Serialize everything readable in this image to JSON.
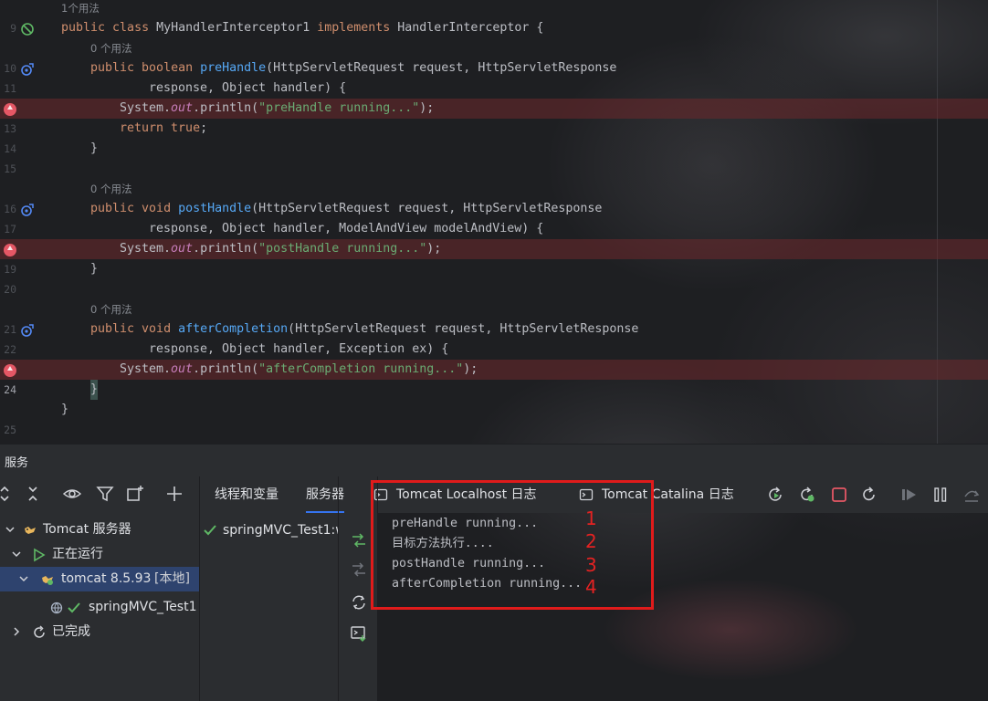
{
  "editor": {
    "usage_hints": [
      "1个用法",
      "0 个用法",
      "0 个用法",
      "0 个用法"
    ],
    "lines": {
      "9": {
        "kw1": "public ",
        "kw2": "class ",
        "name": "MyHandlerInterceptor1 ",
        "kw3": "implements ",
        "rest": "HandlerInterceptor {"
      },
      "10": {
        "kw1": "public ",
        "kw2": "boolean ",
        "fn": "preHandle",
        "rest": "(HttpServletRequest request, HttpServletResponse"
      },
      "11": {
        "text": "response, Object handler) {"
      },
      "12": {
        "a": "System.",
        "field": "out",
        "b": ".println(",
        "str": "\"preHandle running...\"",
        "c": ");"
      },
      "13": {
        "kw1": "return ",
        "kw2": "true",
        "rest": ";"
      },
      "14": {
        "text": "}"
      },
      "16": {
        "kw1": "public ",
        "kw2": "void ",
        "fn": "postHandle",
        "rest": "(HttpServletRequest request, HttpServletResponse"
      },
      "17": {
        "text": "response, Object handler, ModelAndView modelAndView) {"
      },
      "18": {
        "a": "System.",
        "field": "out",
        "b": ".println(",
        "str": "\"postHandle running...\"",
        "c": ");"
      },
      "19": {
        "text": "}"
      },
      "21": {
        "kw1": "public ",
        "kw2": "void ",
        "fn": "afterCompletion",
        "rest": "(HttpServletRequest request, HttpServletResponse"
      },
      "22": {
        "text": "response, Object handler, Exception ex) {"
      },
      "23": {
        "a": "System.",
        "field": "out",
        "b": ".println(",
        "str": "\"afterCompletion running...\"",
        "c": ");"
      },
      "24": {
        "text": "}"
      },
      "25": {
        "text": "}"
      }
    },
    "line_numbers": [
      "9",
      "10",
      "11",
      "12",
      "13",
      "14",
      "15",
      "16",
      "17",
      "18",
      "19",
      "20",
      "21",
      "22",
      "23",
      "24",
      "25"
    ]
  },
  "services": {
    "title": "服务",
    "tree": {
      "tomcat_group": "Tomcat 服务器",
      "running": "正在运行",
      "server": "tomcat 8.5.93",
      "server_tag": "[本地]",
      "artifact": "springMVC_Test1",
      "finished": "已完成"
    },
    "tabs": {
      "threads": "线程和变量",
      "server": "服务器",
      "localhost_log": "Tomcat Localhost 日志",
      "catalina_log": "Tomcat Catalina 日志"
    },
    "deployment": "springMVC_Test1:war exploded",
    "console_lines": [
      "preHandle running...",
      "目标方法执行....",
      "postHandle running...",
      "afterCompletion running..."
    ],
    "annotations": [
      "1",
      "2",
      "3",
      "4"
    ],
    "colors": {
      "accent": "#3574f0",
      "annotation": "#e32222",
      "breakpoint": "#e55765",
      "success": "#5fb865"
    }
  }
}
